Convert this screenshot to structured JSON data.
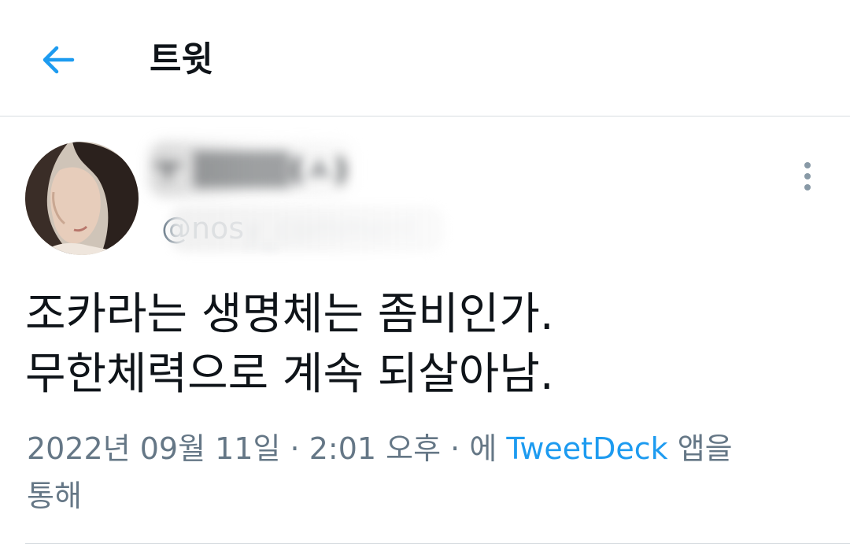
{
  "header": {
    "title": "트윗",
    "back_icon": "arrow-left-icon",
    "accent_color": "#1d9bf0"
  },
  "tweet": {
    "display_name": "ㅜ ▒▒▒▒(ㅅ)",
    "handle_prefix": "@",
    "handle_visible": "nos",
    "handle_obscured": "y_comment",
    "more_icon": "more-vertical-icon",
    "text_lines": [
      "조카라는 생명체는 좀비인가.",
      "무한체력으로 계속 되살아남."
    ],
    "date": "2022년 09월 11일",
    "separator": "·",
    "time": "2:01 오후",
    "via_prefix": "에",
    "source_app": "TweetDeck",
    "via_suffix": "앱을",
    "via_line2": "통해"
  }
}
